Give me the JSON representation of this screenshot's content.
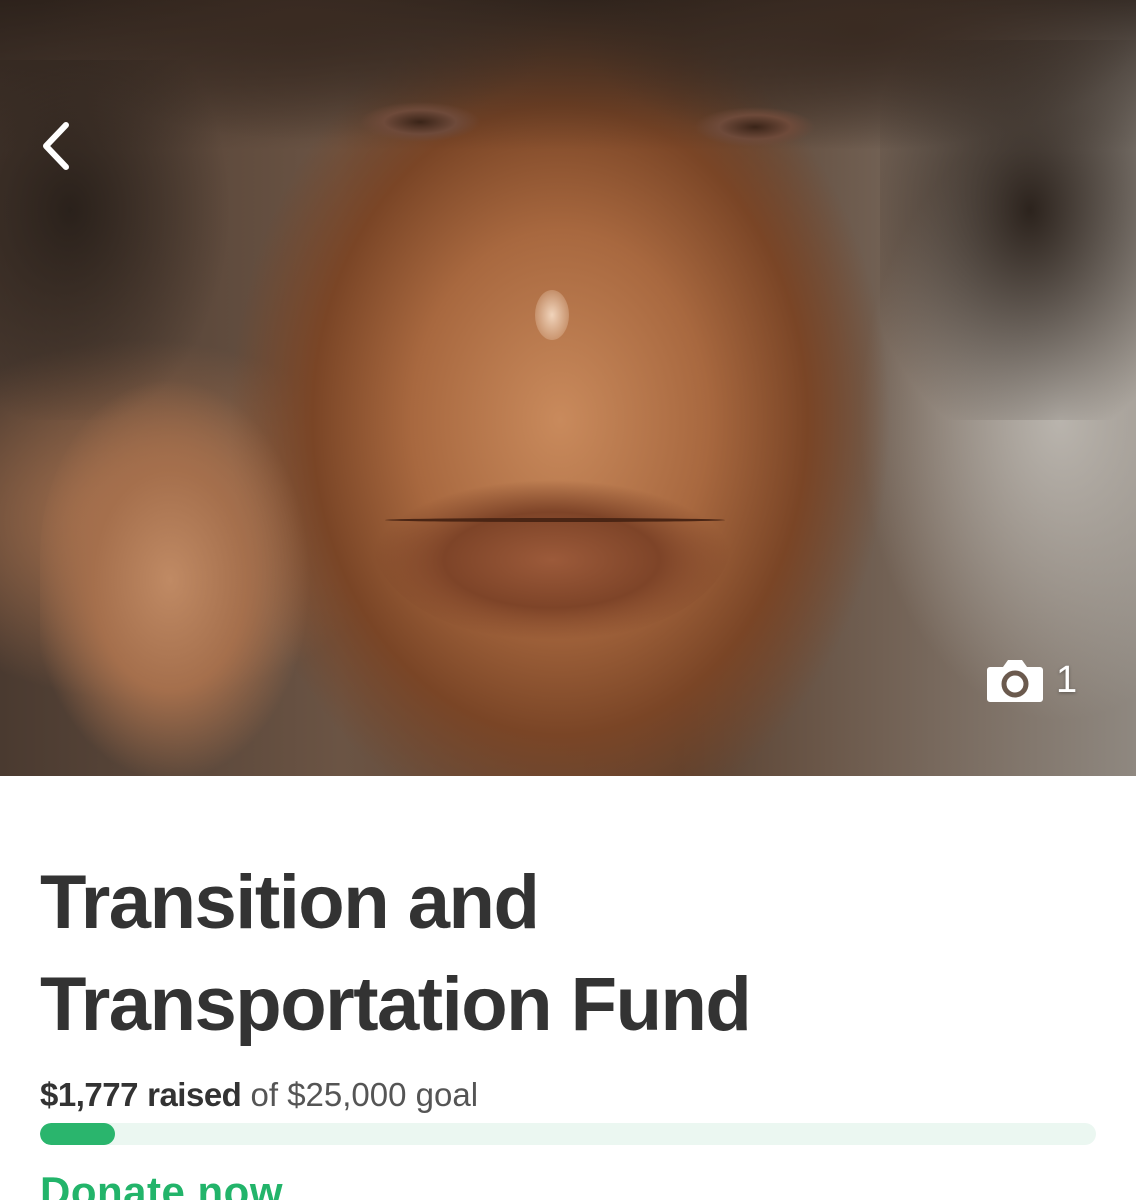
{
  "campaign": {
    "title": "Transition and Transportation Fund",
    "raised_amount": "$1,777",
    "raised_label": "raised",
    "goal_text": "of $25,000 goal",
    "progress_fraction": 0.0711,
    "donate_label": "Donate now"
  },
  "hero": {
    "photo_count": "1",
    "back_icon": "chevron-left-icon",
    "camera_icon": "camera-icon"
  },
  "colors": {
    "accent": "#2ab56d",
    "progress_track": "#ebf7f1",
    "title_text": "#333333"
  }
}
